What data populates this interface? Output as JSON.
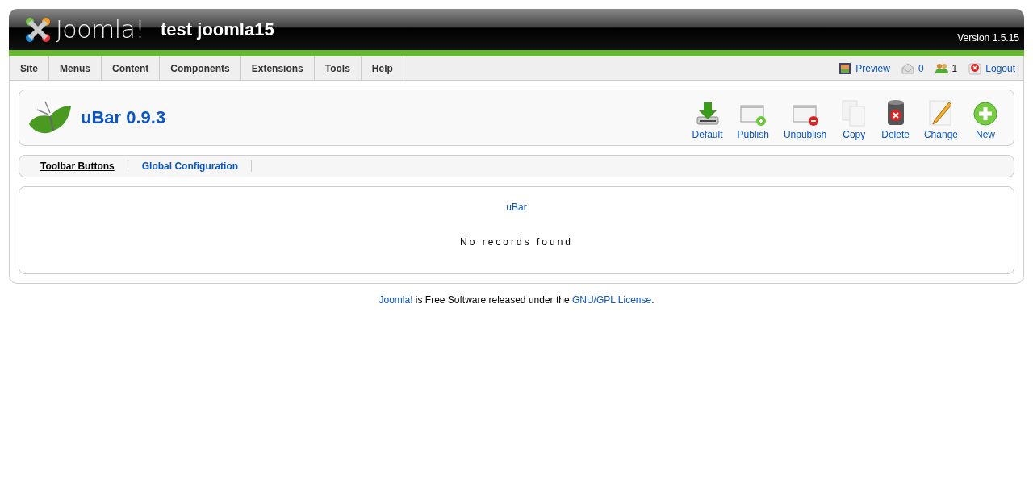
{
  "header": {
    "logo_text": "Joomla!",
    "site_name": "test joomla15",
    "version": "Version 1.5.15"
  },
  "menu": [
    "Site",
    "Menus",
    "Content",
    "Components",
    "Extensions",
    "Tools",
    "Help"
  ],
  "status": [
    {
      "kind": "preview",
      "label": "Preview"
    },
    {
      "kind": "messages",
      "label": "0"
    },
    {
      "kind": "users",
      "label": "1"
    },
    {
      "kind": "logout",
      "label": "Logout"
    }
  ],
  "toolbar": {
    "title": "uBar 0.9.3",
    "buttons": [
      {
        "kind": "default",
        "label": "Default"
      },
      {
        "kind": "publish",
        "label": "Publish"
      },
      {
        "kind": "unpublish",
        "label": "Unpublish"
      },
      {
        "kind": "copy",
        "label": "Copy"
      },
      {
        "kind": "delete",
        "label": "Delete"
      },
      {
        "kind": "edit",
        "label": "Change"
      },
      {
        "kind": "new",
        "label": "New"
      }
    ]
  },
  "submenu": [
    {
      "label": "Toolbar Buttons",
      "selected": true
    },
    {
      "label": "Global Configuration",
      "selected": false
    }
  ],
  "content": {
    "heading": "uBar",
    "message": "No records found"
  },
  "footer": {
    "link_1": "Joomla!",
    "text": " is Free Software released under the ",
    "link_2": "GNU/GPL License",
    "end": "."
  }
}
